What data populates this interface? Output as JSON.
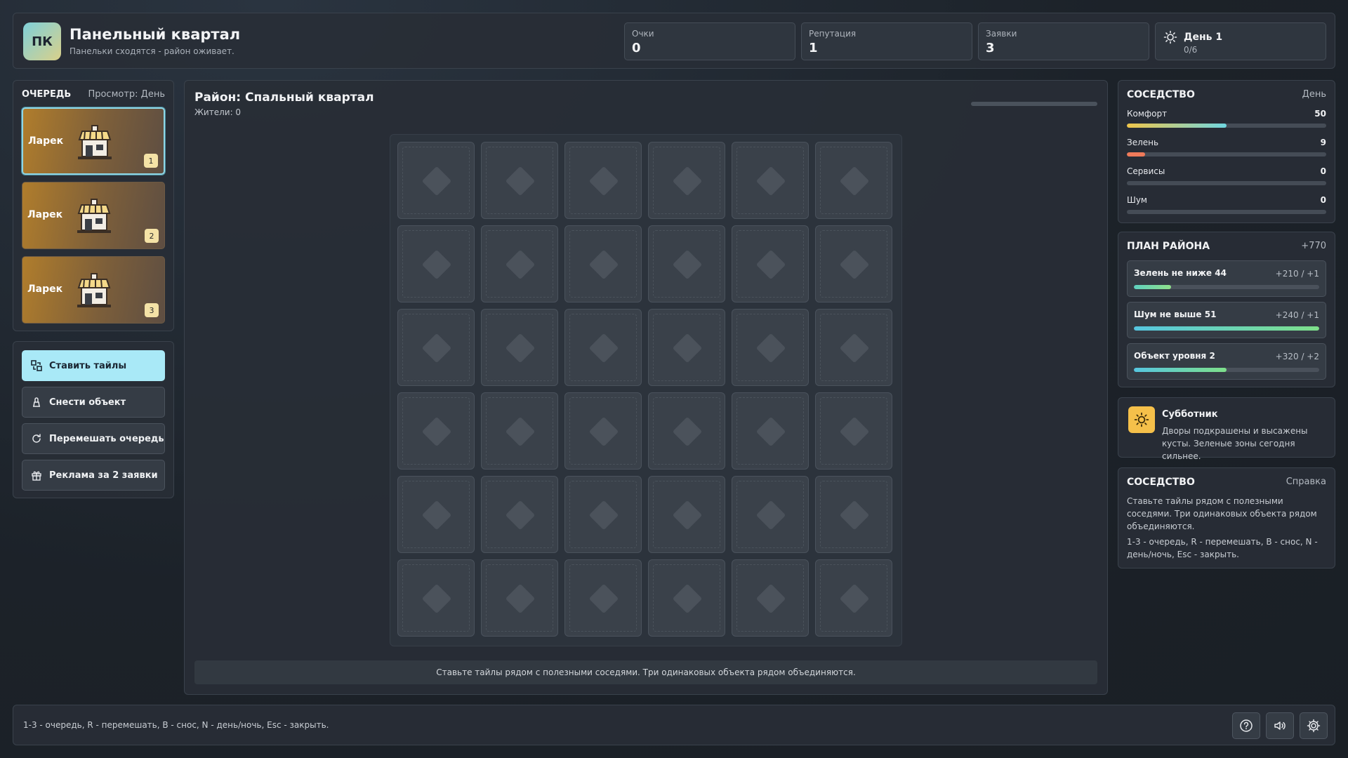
{
  "header": {
    "logo": "ПК",
    "title": "Панельный квартал",
    "subtitle": "Панельки сходятся - район оживает.",
    "stats": [
      {
        "label": "Очки",
        "value": "0"
      },
      {
        "label": "Репутация",
        "value": "1"
      },
      {
        "label": "Заявки",
        "value": "3"
      }
    ],
    "day": {
      "label": "День 1",
      "sub": "0/6",
      "icon": "sun-icon"
    }
  },
  "queue": {
    "title": "ОЧЕРЕДЬ",
    "view": "Просмотр: День",
    "items": [
      {
        "label": "Ларек",
        "num": "1",
        "icon": "kiosk-icon",
        "selected": true
      },
      {
        "label": "Ларек",
        "num": "2",
        "icon": "kiosk-icon",
        "selected": false
      },
      {
        "label": "Ларек",
        "num": "3",
        "icon": "kiosk-icon",
        "selected": false
      }
    ]
  },
  "actions": [
    {
      "label": "Ставить тайлы",
      "icon": "place-tiles-icon",
      "primary": true
    },
    {
      "label": "Снести объект",
      "icon": "demolish-icon",
      "primary": false
    },
    {
      "label": "Перемешать очередь",
      "icon": "shuffle-icon",
      "primary": false
    },
    {
      "label": "Реклама за 2 заявки",
      "icon": "gift-icon",
      "primary": false
    }
  ],
  "board": {
    "title": "Район: Спальный квартал",
    "residents": "Жители: 0",
    "rows": 6,
    "cols": 6,
    "hint": "Ставьте тайлы рядом с полезными соседями. Три одинаковых объекта рядом объединяются."
  },
  "neighborhood": {
    "title": "СОСЕДСТВО",
    "mode": "День",
    "metrics": [
      {
        "label": "Комфорт",
        "value": "50",
        "fraction": 0.5,
        "color": "linear-gradient(90deg,#f0c64a,#6fd6e0)"
      },
      {
        "label": "Зелень",
        "value": "9",
        "fraction": 0.09,
        "color": "#ef7a5a"
      },
      {
        "label": "Сервисы",
        "value": "0",
        "fraction": 0,
        "color": "#6fd6e0"
      },
      {
        "label": "Шум",
        "value": "0",
        "fraction": 0,
        "color": "#6fd6e0"
      }
    ]
  },
  "plan": {
    "title": "ПЛАН РАЙОНА",
    "total": "+770",
    "goals": [
      {
        "label": "Зелень не ниже 44",
        "reward": "+210 / +1",
        "fraction": 0.2,
        "color": "linear-gradient(90deg,#5fd0c0,#8fe08a)"
      },
      {
        "label": "Шум не выше 51",
        "reward": "+240 / +1",
        "fraction": 1.0,
        "color": "linear-gradient(90deg,#56c6e0,#7ee08a)"
      },
      {
        "label": "Объект уровня 2",
        "reward": "+320 / +2",
        "fraction": 0.5,
        "color": "linear-gradient(90deg,#56c6e0,#7ee08a)"
      }
    ]
  },
  "event": {
    "icon": "sun-icon",
    "title": "Субботник",
    "desc": "Дворы подкрашены и высажены кусты. Зеленые зоны сегодня сильнее."
  },
  "help": {
    "title": "СОСЕДСТВО",
    "link": "Справка",
    "text1": "Ставьте тайлы рядом с полезными соседями. Три одинаковых объекта рядом объединяются.",
    "text2": "1-3 - очередь, R - перемешать, B - снос, N - день/ночь, Esc - закрыть."
  },
  "footer": {
    "hint": "1-3 - очередь, R - перемешать, B - снос, N - день/ночь, Esc - закрыть.",
    "buttons": [
      {
        "icon": "help-icon"
      },
      {
        "icon": "sound-icon"
      },
      {
        "icon": "settings-icon"
      }
    ]
  }
}
